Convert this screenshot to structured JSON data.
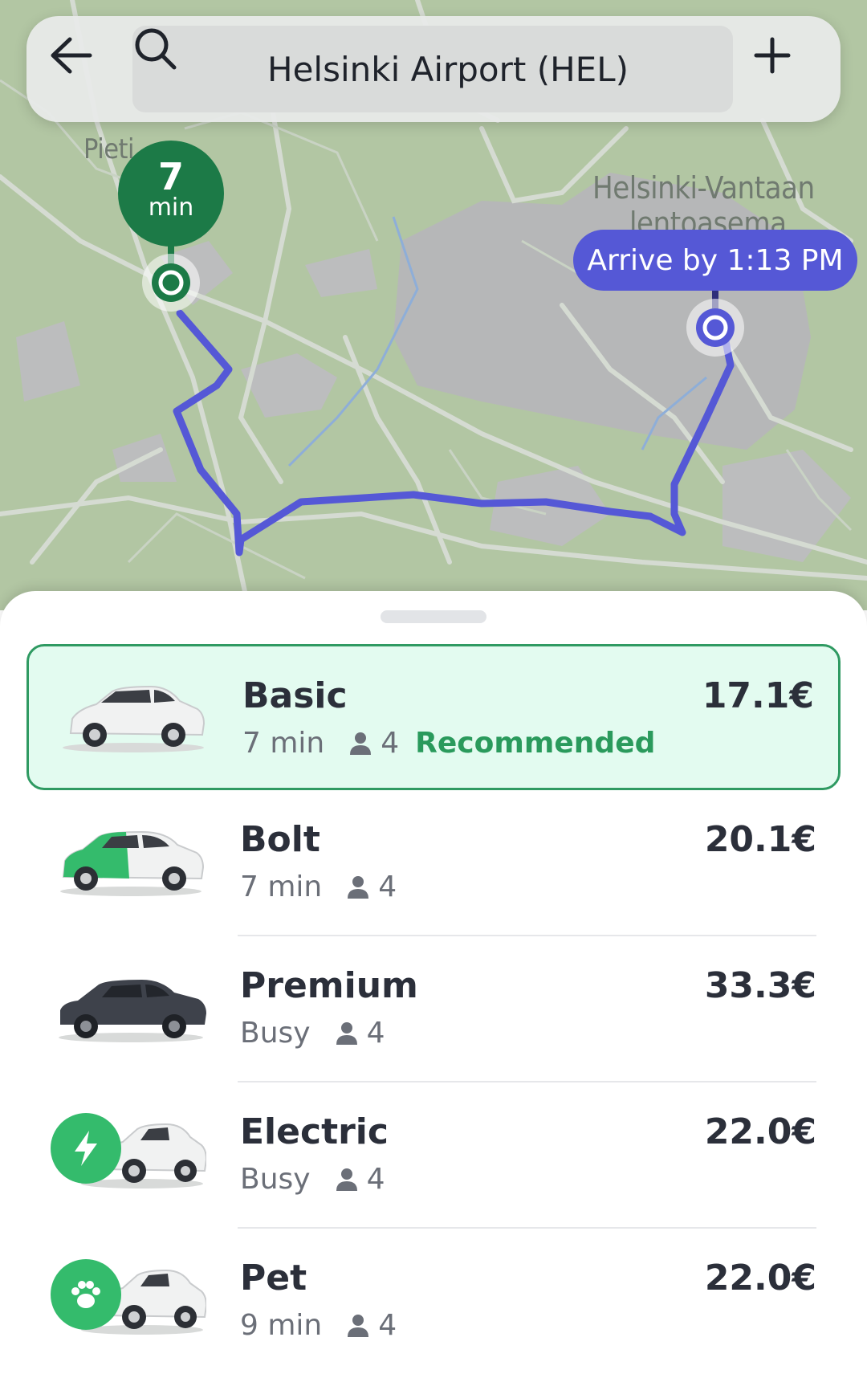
{
  "search": {
    "back_icon": "arrow-left-icon",
    "search_icon": "search-icon",
    "destination": "Helsinki Airport (HEL)",
    "add_icon": "plus-icon"
  },
  "map": {
    "labels": {
      "pieti": "Pieti",
      "airport_line1": "Helsinki-Vantaan",
      "airport_line2": "lentoasema"
    },
    "pickup_eta": {
      "value": "7",
      "unit": "min"
    },
    "arrival": "Arrive by 1:13 PM",
    "route_color": "#5558d6",
    "pickup_color": "#1c7a47"
  },
  "rides": [
    {
      "name": "Basic",
      "status": "7 min",
      "seats": "4",
      "badge": "Recommended",
      "price": "17.1€",
      "selected": true
    },
    {
      "name": "Bolt",
      "status": "7 min",
      "seats": "4",
      "price": "20.1€"
    },
    {
      "name": "Premium",
      "status": "Busy",
      "seats": "4",
      "price": "33.3€"
    },
    {
      "name": "Electric",
      "status": "Busy",
      "seats": "4",
      "price": "22.0€",
      "badge_icon": "lightning-icon"
    },
    {
      "name": "Pet",
      "status": "9 min",
      "seats": "4",
      "price": "22.0€",
      "badge_icon": "paw-icon"
    }
  ],
  "colors": {
    "accent_green": "#34bb6c",
    "selected_bg": "#e3fbf0",
    "route_blue": "#5558d6"
  }
}
